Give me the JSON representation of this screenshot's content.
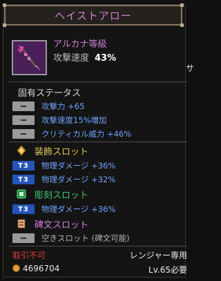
{
  "item": {
    "name": "ヘイストアロー",
    "rarity": "アルカナ等級",
    "stat_label": "攻撃速度",
    "stat_value": "43%",
    "side_char": "サ"
  },
  "unique_stats": {
    "title": "固有ステータス",
    "rows": [
      "攻撃力 +65",
      "攻撃速度15%増加",
      "クリティカル威力 +46%"
    ]
  },
  "ornament_slot": {
    "title": "装飾スロット",
    "badge": "T3",
    "rows": [
      "物理ダメージ +36%",
      "物理ダメージ +32%"
    ]
  },
  "engrave_slot": {
    "title": "彫刻スロット",
    "badge": "T3",
    "rows": [
      "物理ダメージ +36%"
    ]
  },
  "monument_slot": {
    "title": "碑文スロット",
    "rows": [
      "空きスロット (碑文可能)"
    ]
  },
  "footer": {
    "trade": "取引不可",
    "class_req": "レンジャー専用",
    "gold": "4696704",
    "level_req": "Lv.65必要"
  },
  "colors": {
    "arcana_purple": "#d07fd8",
    "stat_blue": "#6fa3ff",
    "slot_gold": "#e3c553",
    "slot_green": "#42c96b",
    "tier_badge_blue": "#2553b7",
    "no_trade_red": "#e23b3b"
  }
}
